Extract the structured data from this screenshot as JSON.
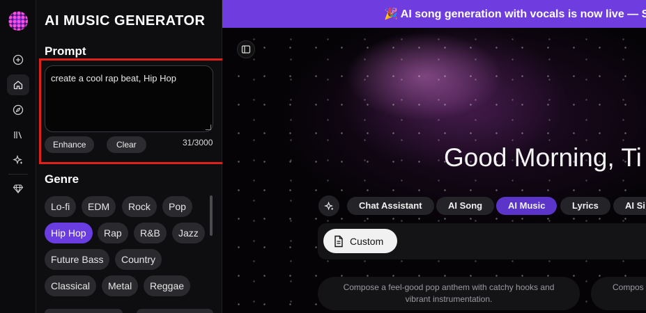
{
  "rail": {
    "icons": [
      "plus-circle-icon",
      "home-icon",
      "compass-icon",
      "library-icon",
      "sparkle-icon",
      "diamond-icon"
    ],
    "active": "home-icon"
  },
  "panel": {
    "title": "AI MUSIC GENERATOR",
    "prompt_title": "Prompt",
    "prompt_value": "create a cool rap beat, Hip Hop",
    "enhance_label": "Enhance",
    "clear_label": "Clear",
    "counter": "31/3000",
    "genre_title": "Genre",
    "genres": [
      "Lo-fi",
      "EDM",
      "Rock",
      "Pop",
      "Hip Hop",
      "Rap",
      "R&B",
      "Jazz",
      "Future Bass",
      "Country",
      "Classical",
      "Metal",
      "Reggae"
    ],
    "selected_genre": "Hip Hop"
  },
  "main": {
    "banner": "🎉 AI song generation with vocals is now live — S",
    "greeting": "Good Morning, Ti",
    "tabs": [
      "Chat Assistant",
      "AI Song",
      "AI Music",
      "Lyrics",
      "AI Si"
    ],
    "selected_tab": "AI Music",
    "custom_label": "Custom",
    "suggestions": [
      "Compose a feel-good pop anthem with catchy hooks and vibrant instrumentation.",
      "Compos"
    ]
  },
  "colors": {
    "accent": "#6a3de0",
    "banner": "#6f3ce0",
    "highlight": "#e0201b"
  }
}
